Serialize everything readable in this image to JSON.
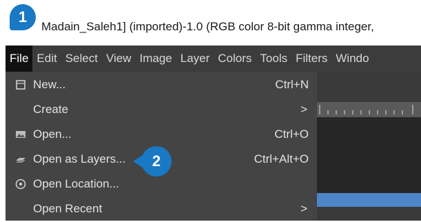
{
  "window": {
    "title": "Madain_Saleh1] (imported)-1.0 (RGB color 8-bit gamma integer,"
  },
  "menubar": {
    "items": [
      {
        "label": "File",
        "active": true
      },
      {
        "label": "Edit"
      },
      {
        "label": "Select"
      },
      {
        "label": "View"
      },
      {
        "label": "Image"
      },
      {
        "label": "Layer"
      },
      {
        "label": "Colors"
      },
      {
        "label": "Tools"
      },
      {
        "label": "Filters"
      },
      {
        "label": "Windo"
      }
    ]
  },
  "file_menu": {
    "items": [
      {
        "label": "New...",
        "shortcut": "Ctrl+N",
        "icon": "new-image-icon"
      },
      {
        "label": "Create",
        "submenu_arrow": ">"
      },
      {
        "label": "Open...",
        "shortcut": "Ctrl+O",
        "icon": "open-image-icon"
      },
      {
        "label": "Open as Layers...",
        "shortcut": "Ctrl+Alt+O",
        "icon": "open-layers-icon"
      },
      {
        "label": "Open Location...",
        "icon": "open-location-icon"
      },
      {
        "label": "Open Recent",
        "submenu_arrow": ">"
      }
    ]
  },
  "callouts": {
    "step1": "1",
    "step2": "2"
  },
  "colors": {
    "menubar_bg": "#3c3c3c",
    "menu_bg": "#444444",
    "callout_blue": "#1979c4",
    "canvas_blue": "#4e84c8"
  }
}
